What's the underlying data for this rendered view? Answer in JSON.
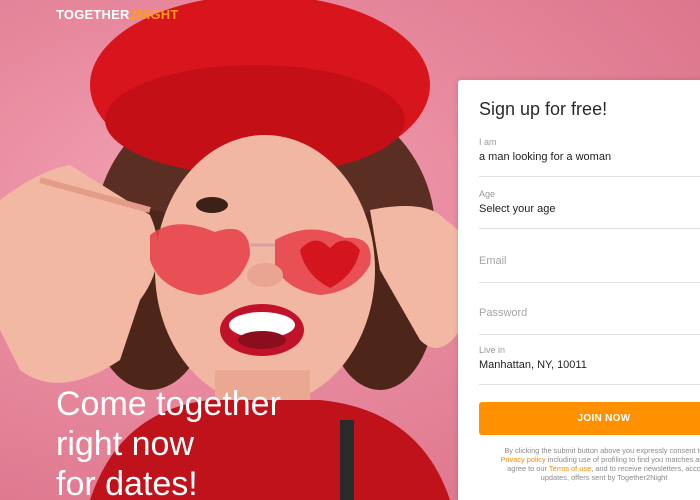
{
  "brand": {
    "logo_part1": "TOGETHER",
    "logo_part2": "2NIGHT",
    "accent_color": "#ff9a1f"
  },
  "hero": {
    "headline_lines": [
      "Come together",
      "right now",
      "for dates!"
    ]
  },
  "signup": {
    "title": "Sign up for free!",
    "fields": {
      "i_am": {
        "label": "I am",
        "value": "a man looking for a woman"
      },
      "age": {
        "label": "Age",
        "value": "Select your age"
      },
      "email": {
        "placeholder": "Email"
      },
      "password": {
        "placeholder": "Password"
      },
      "live_in": {
        "label": "Live in",
        "value": "Manhattan, NY, 10011"
      }
    },
    "join_label": "JOIN NOW",
    "join_color": "#ff9100",
    "terms": {
      "line1": "By clicking the submit button above you expressly consent to",
      "privacy_link": "Privacy policy",
      "line2_rest": " including use of profiling to find you matches and",
      "line3_start": "agree to our ",
      "terms_link": "Terms of use",
      "line3_rest": ", and to receive newsletters, acco",
      "line4": "updates, offers sent by Together2Night"
    }
  }
}
